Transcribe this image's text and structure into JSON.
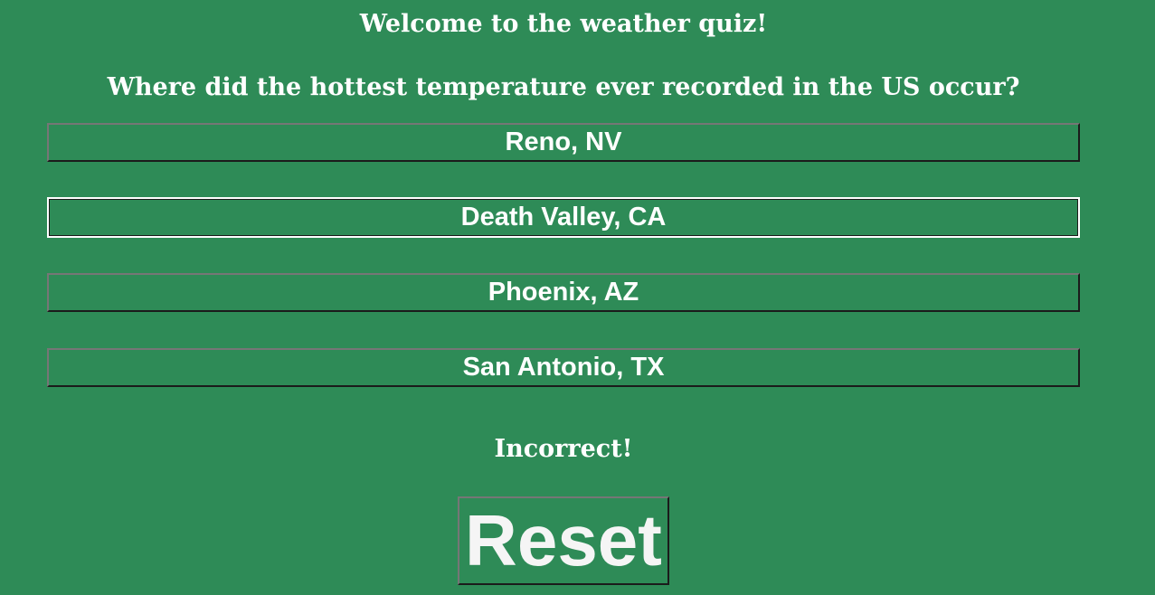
{
  "quiz": {
    "welcome": "Welcome to the weather quiz!",
    "question": "Where did the hottest temperature ever recorded in the US occur?",
    "answers": [
      {
        "label": "Reno, NV"
      },
      {
        "label": "Death Valley, CA"
      },
      {
        "label": "Phoenix, AZ"
      },
      {
        "label": "San Antonio, TX"
      }
    ],
    "result": "Incorrect!",
    "reset_label": "Reset"
  },
  "colors": {
    "background": "#2e8b57",
    "text": "#ffffff"
  }
}
